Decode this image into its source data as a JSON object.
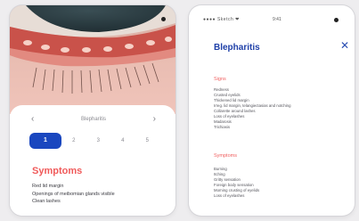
{
  "left_screen": {
    "nav": {
      "prev_icon": "‹",
      "title": "Blepharitis",
      "next_icon": "›"
    },
    "tabs": [
      "1",
      "2",
      "3",
      "4",
      "5"
    ],
    "active_tab_index": 0,
    "symptoms": {
      "heading": "Symptoms",
      "items": [
        "Red lid margin",
        "Openings of meibomian glands visible",
        "Clean lashes"
      ]
    }
  },
  "right_screen": {
    "status": {
      "signal": "●●●● Sketch ❤",
      "time": "9:41"
    },
    "title": "Blepharitis",
    "close_icon": "✕",
    "signs": {
      "heading": "Signs",
      "items": [
        "Redness",
        "Crusted eyelids",
        "Thickened lid margin",
        "Irreg. lid margin, telangiectasias and notching",
        "Collarette around lashes",
        "Loss of eyelashes",
        "Madarosis",
        "Trichiasis"
      ]
    },
    "symptoms": {
      "heading": "Symptoms",
      "items": [
        "Burning",
        "Itching",
        "Gritty sensation",
        "Foreign body sensation",
        "Morning crusting of eyelids",
        "Loss of eyelashes"
      ]
    }
  }
}
